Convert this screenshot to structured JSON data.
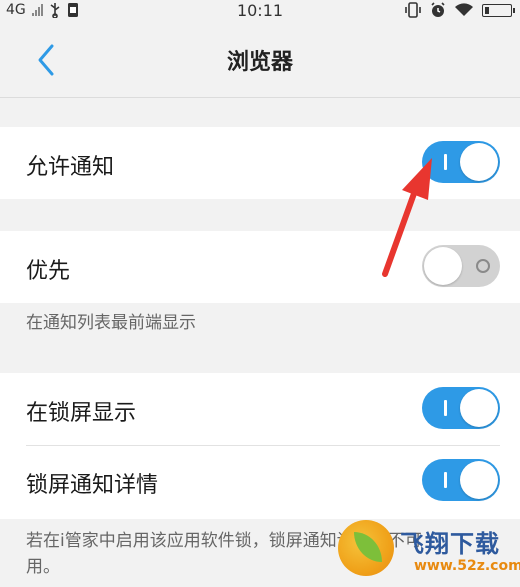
{
  "status_bar": {
    "network": "4G",
    "time": "10:11"
  },
  "header": {
    "title": "浏览器",
    "back_icon": "chevron-left-icon"
  },
  "settings": {
    "allow_notifications": {
      "label": "允许通知",
      "enabled": true
    },
    "priority": {
      "label": "优先",
      "enabled": false,
      "note": "在通知列表最前端显示"
    },
    "lock_screen_display": {
      "label": "在锁屏显示",
      "enabled": true
    },
    "lock_screen_details": {
      "label": "锁屏通知详情",
      "enabled": true
    },
    "footer_note_line1": "若在i管家中启用该应用软件锁，锁屏通知详情将不可",
    "footer_note_line2": "用。"
  },
  "watermark": {
    "brand": "飞翔下载",
    "url": "www.52z.com"
  },
  "colors": {
    "toggle_on": "#2e9ae6",
    "toggle_off": "#d2d2d2",
    "accent_back": "#2e9ae6",
    "arrow": "#e8362f"
  }
}
